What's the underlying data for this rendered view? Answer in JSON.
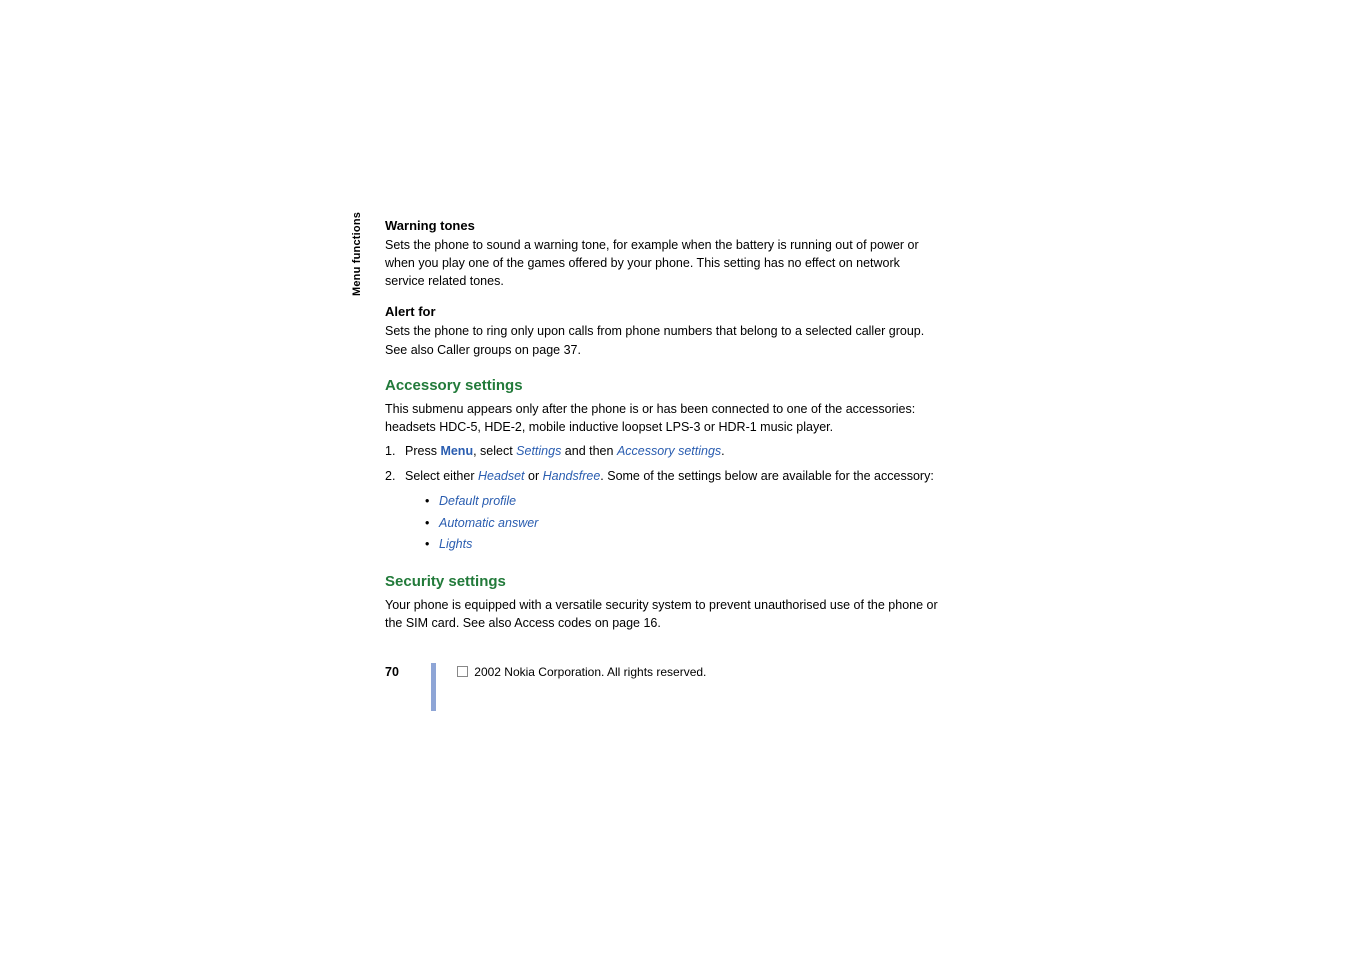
{
  "sidebar": {
    "label": "Menu functions"
  },
  "sections": {
    "warning_tones": {
      "title": "Warning tones",
      "body": "Sets the phone to sound a warning tone, for example when the battery is running out of power or when you play one of the games offered by your phone. This setting has no effect on network service related tones."
    },
    "alert_for": {
      "title": "Alert for",
      "body": "Sets the phone to ring only upon calls from phone numbers that belong to a selected caller group. See also Caller groups on page 37."
    },
    "accessory": {
      "heading": "Accessory settings",
      "intro": "This submenu appears only after the phone is or has been connected to one of the accessories: headsets HDC-5, HDE-2, mobile inductive loopset LPS-3 or HDR-1 music player.",
      "step1_num": "1.",
      "step1_a": "Press ",
      "step1_menu": "Menu",
      "step1_b": ", select ",
      "step1_settings": "Settings",
      "step1_c": " and then ",
      "step1_accessory": "Accessory settings",
      "step1_d": ".",
      "step2_num": "2.",
      "step2_a": "Select either ",
      "step2_headset": "Headset",
      "step2_b": " or ",
      "step2_handsfree": "Handsfree",
      "step2_c": ". Some of the settings below are available for the accessory:",
      "bullets": {
        "b1": "Default profile",
        "b2": "Automatic answer",
        "b3": "Lights"
      }
    },
    "security": {
      "heading": "Security settings",
      "body": "Your phone is equipped with a versatile security system to prevent unauthorised use of the phone or the SIM card. See also Access codes on page 16."
    }
  },
  "footer": {
    "page_number": "70",
    "copyright": " 2002 Nokia Corporation. All rights reserved."
  }
}
